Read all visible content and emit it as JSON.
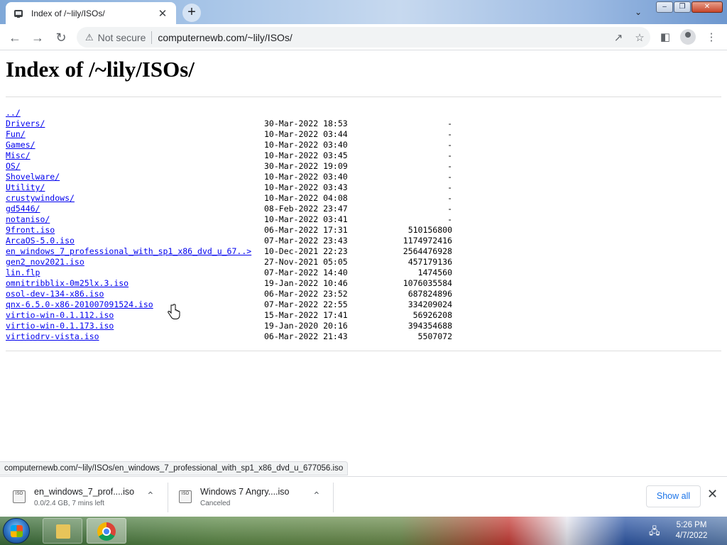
{
  "browser": {
    "tab_title": "Index of /~lily/ISOs/",
    "tab_close": "✕",
    "new_tab": "+",
    "address": {
      "security_label": "Not secure",
      "url": "computernewb.com/~lily/ISOs/"
    },
    "status_url": "computernewb.com/~lily/ISOs/en_windows_7_professional_with_sp1_x86_dvd_u_677056.iso"
  },
  "page": {
    "heading": "Index of /~lily/ISOs/",
    "parent_link": "../",
    "entries": [
      {
        "name": "Drivers/",
        "date": "30-Mar-2022 18:53",
        "size": "-"
      },
      {
        "name": "Fun/",
        "date": "10-Mar-2022 03:44",
        "size": "-"
      },
      {
        "name": "Games/",
        "date": "10-Mar-2022 03:40",
        "size": "-"
      },
      {
        "name": "Misc/",
        "date": "10-Mar-2022 03:45",
        "size": "-"
      },
      {
        "name": "OS/",
        "date": "30-Mar-2022 19:09",
        "size": "-"
      },
      {
        "name": "Shovelware/",
        "date": "10-Mar-2022 03:40",
        "size": "-"
      },
      {
        "name": "Utility/",
        "date": "10-Mar-2022 03:43",
        "size": "-"
      },
      {
        "name": "crustywindows/",
        "date": "10-Mar-2022 04:08",
        "size": "-"
      },
      {
        "name": "gd5446/",
        "date": "08-Feb-2022 23:47",
        "size": "-"
      },
      {
        "name": "notaniso/",
        "date": "10-Mar-2022 03:41",
        "size": "-"
      },
      {
        "name": "9front.iso",
        "date": "06-Mar-2022 17:31",
        "size": "510156800"
      },
      {
        "name": "ArcaOS-5.0.iso",
        "date": "07-Mar-2022 23:43",
        "size": "1174972416"
      },
      {
        "name": "en_windows_7_professional_with_sp1_x86_dvd_u_67..>",
        "date": "10-Dec-2021 22:23",
        "size": "2564476928"
      },
      {
        "name": "gen2_nov2021.iso",
        "date": "27-Nov-2021 05:05",
        "size": "457179136"
      },
      {
        "name": "lin.flp",
        "date": "07-Mar-2022 14:40",
        "size": "1474560"
      },
      {
        "name": "omnitribblix-0m25lx.3.iso",
        "date": "19-Jan-2022 10:46",
        "size": "1076035584"
      },
      {
        "name": "osol-dev-134-x86.iso",
        "date": "06-Mar-2022 23:52",
        "size": "687824896"
      },
      {
        "name": "qnx-6.5.0-x86-201007091524.iso",
        "date": "07-Mar-2022 22:55",
        "size": "334209024"
      },
      {
        "name": "virtio-win-0.1.112.iso",
        "date": "15-Mar-2022 17:41",
        "size": "56926208"
      },
      {
        "name": "virtio-win-0.1.173.iso",
        "date": "19-Jan-2020 20:16",
        "size": "394354688"
      },
      {
        "name": "virtiodrv-vista.iso",
        "date": "06-Mar-2022 21:43",
        "size": "5507072"
      }
    ]
  },
  "downloads": {
    "items": [
      {
        "name": "en_windows_7_prof....iso",
        "status": "0.0/2.4 GB, 7 mins left",
        "icon_label": "ISO"
      },
      {
        "name": "Windows 7 Angry....iso",
        "status": "Canceled",
        "icon_label": "ISO"
      }
    ],
    "show_all_label": "Show all",
    "close": "✕"
  },
  "taskbar": {
    "time": "5:26 PM",
    "date": "4/7/2022"
  },
  "colors": {
    "link": "#0000ee",
    "visited_link": "#551a8b",
    "show_all": "#1a73e8"
  },
  "icons": [
    "site-favicon",
    "back-arrow-icon",
    "forward-arrow-icon",
    "reload-icon",
    "warning-icon",
    "share-icon",
    "star-icon",
    "side-panel-icon",
    "profile-icon",
    "menu-kebab-icon",
    "chevron-up-icon",
    "close-icon",
    "windows-start-icon",
    "folder-icon",
    "chrome-icon",
    "network-icon",
    "pointer-hand-cursor"
  ]
}
